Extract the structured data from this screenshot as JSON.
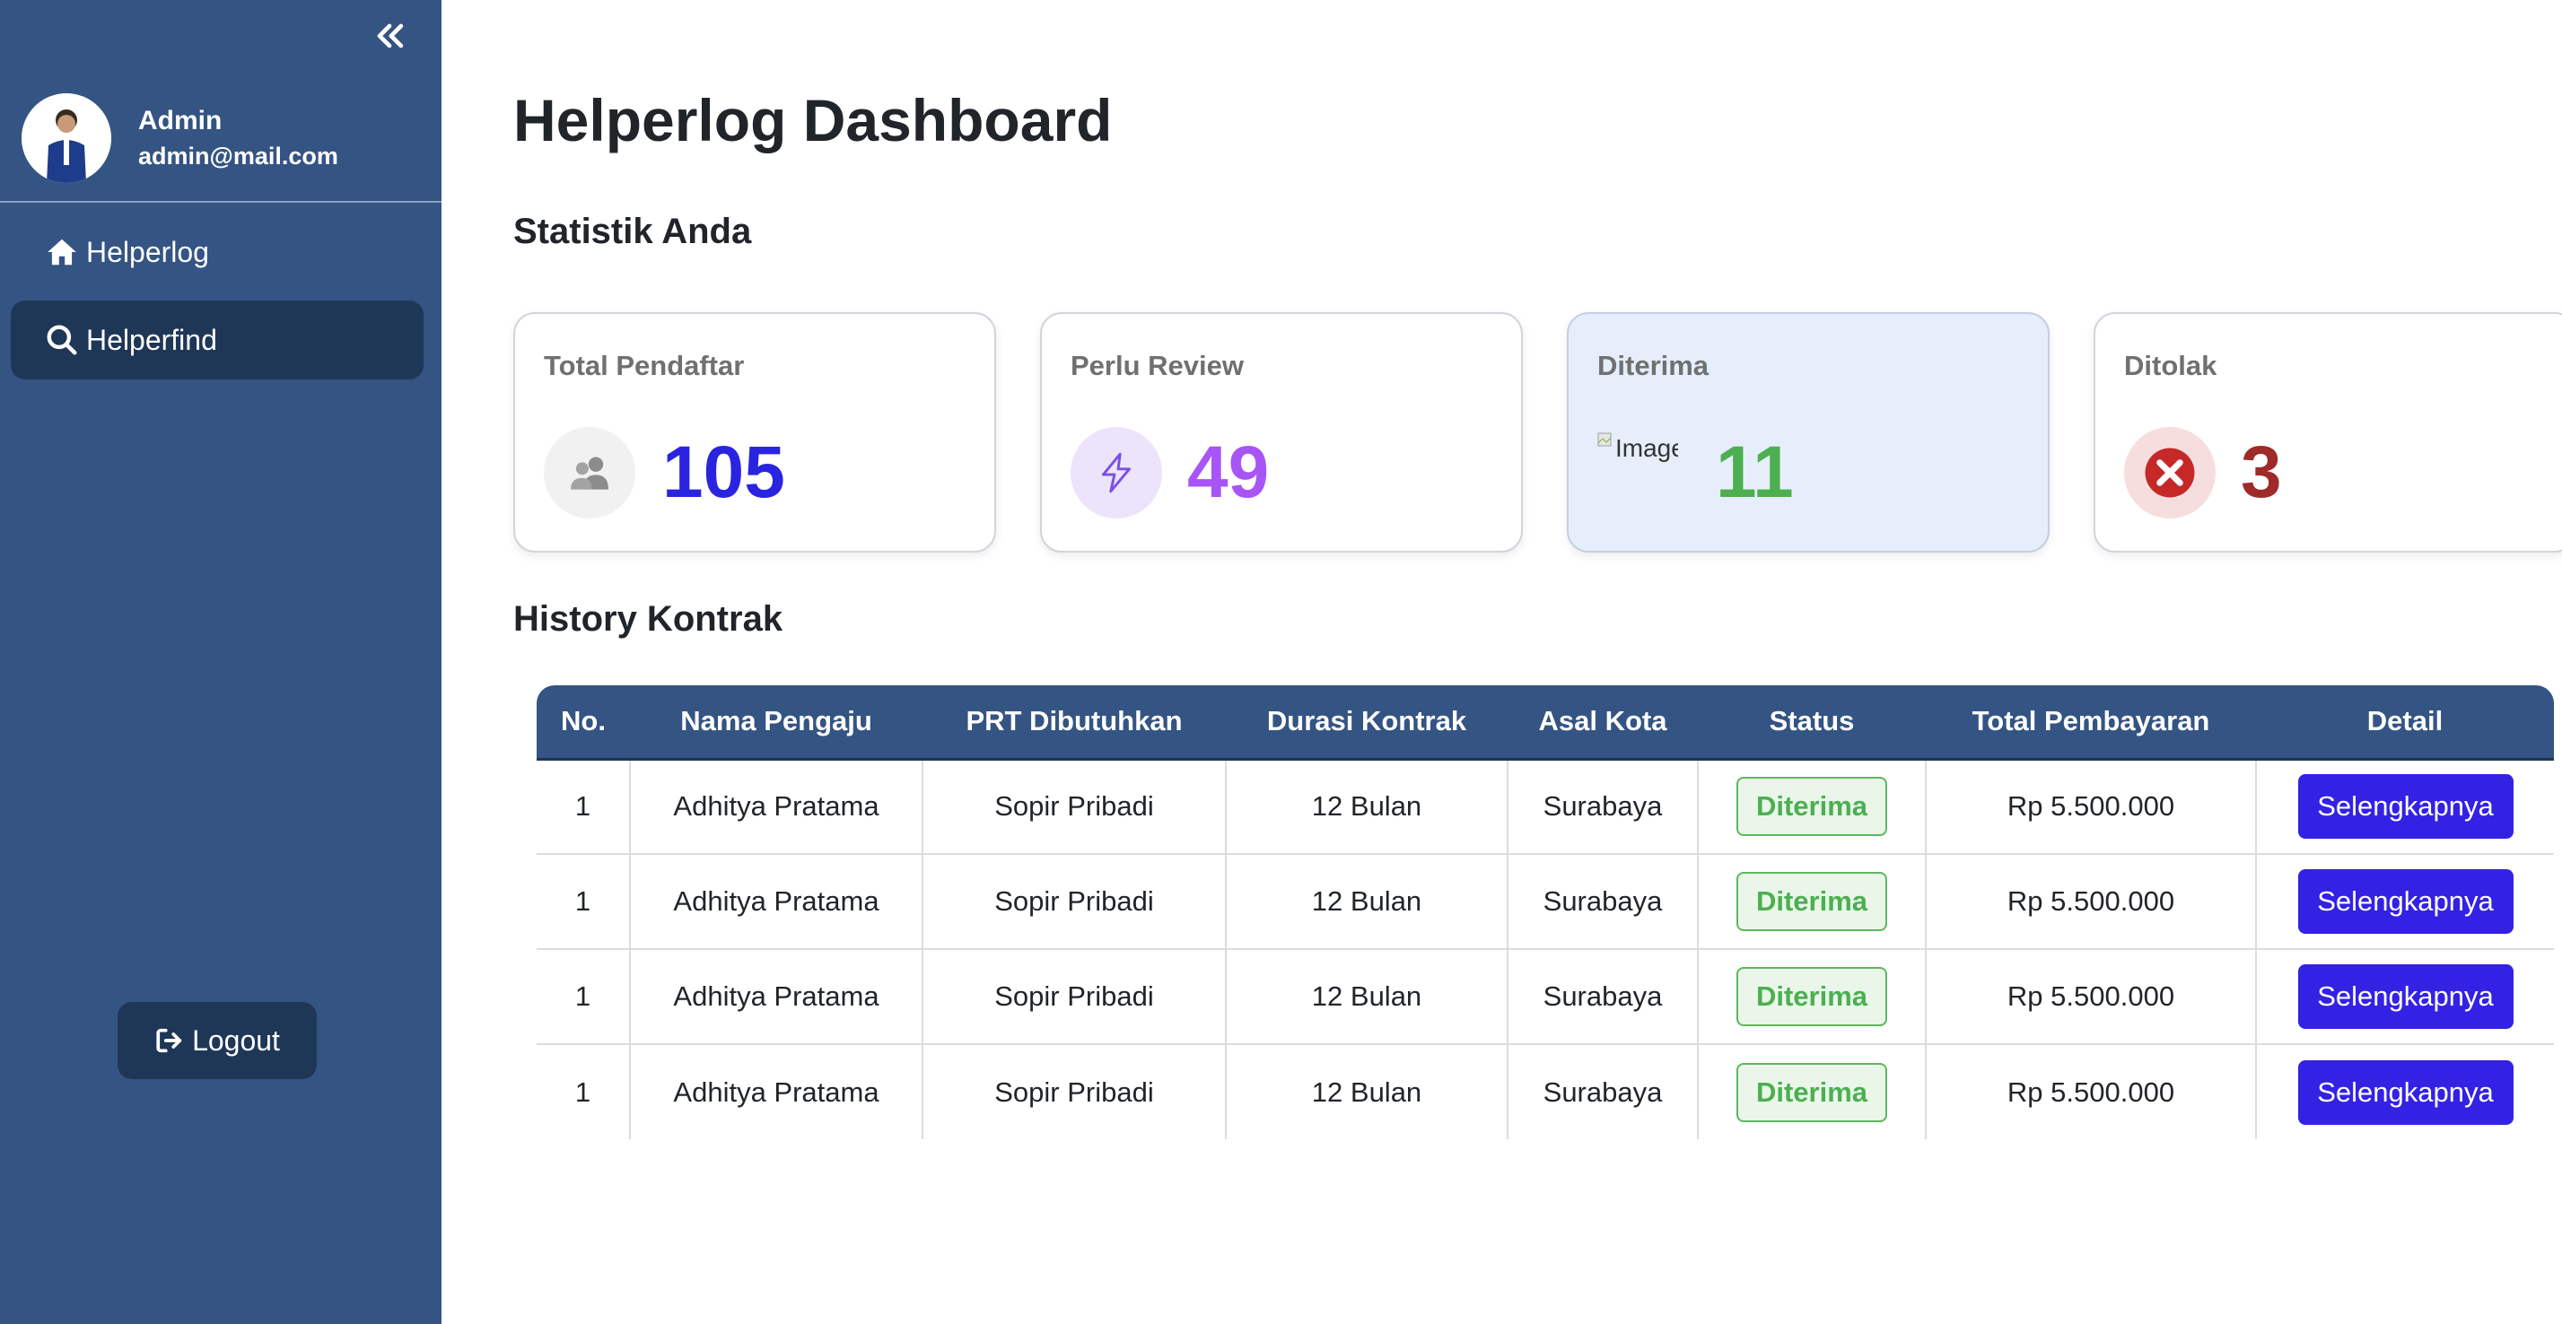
{
  "sidebar": {
    "profile": {
      "name": "Admin",
      "email": "admin@mail.com"
    },
    "items": [
      {
        "label": "Helperlog",
        "icon": "home-icon"
      },
      {
        "label": "Helperfind",
        "icon": "search-icon"
      }
    ],
    "logout_label": "Logout"
  },
  "main": {
    "title": "Helperlog Dashboard",
    "stats_heading": "Statistik Anda",
    "history_heading": "History Kontrak"
  },
  "stats": [
    {
      "label": "Total Pendaftar",
      "value": "105",
      "color": "#2a24e0",
      "icon": "users-icon"
    },
    {
      "label": "Perlu Review",
      "value": "49",
      "color": "#a855f7",
      "icon": "lightning-icon"
    },
    {
      "label": "Diterima",
      "value": "11",
      "color": "#4caf50",
      "icon": "broken-image",
      "image_alt": "Image"
    },
    {
      "label": "Ditolak",
      "value": "3",
      "color": "#9e2a2a",
      "icon": "x-circle-icon"
    }
  ],
  "table": {
    "headers": [
      "No.",
      "Nama Pengaju",
      "PRT Dibutuhkan",
      "Durasi Kontrak",
      "Asal Kota",
      "Status",
      "Total Pembayaran",
      "Detail"
    ],
    "rows": [
      {
        "no": "1",
        "nama": "Adhitya Pratama",
        "prt": "Sopir Pribadi",
        "durasi": "12 Bulan",
        "kota": "Surabaya",
        "status": "Diterima",
        "total": "Rp 5.500.000",
        "detail": "Selengkapnya"
      },
      {
        "no": "1",
        "nama": "Adhitya Pratama",
        "prt": "Sopir Pribadi",
        "durasi": "12 Bulan",
        "kota": "Surabaya",
        "status": "Diterima",
        "total": "Rp 5.500.000",
        "detail": "Selengkapnya"
      },
      {
        "no": "1",
        "nama": "Adhitya Pratama",
        "prt": "Sopir Pribadi",
        "durasi": "12 Bulan",
        "kota": "Surabaya",
        "status": "Diterima",
        "total": "Rp 5.500.000",
        "detail": "Selengkapnya"
      },
      {
        "no": "1",
        "nama": "Adhitya Pratama",
        "prt": "Sopir Pribadi",
        "durasi": "12 Bulan",
        "kota": "Surabaya",
        "status": "Diterima",
        "total": "Rp 5.500.000",
        "detail": "Selengkapnya"
      }
    ]
  },
  "colors": {
    "sidebar": "#345483",
    "sidebar_active": "#1f3757",
    "accent_button": "#3322e4",
    "status_success": "#4caf50"
  }
}
